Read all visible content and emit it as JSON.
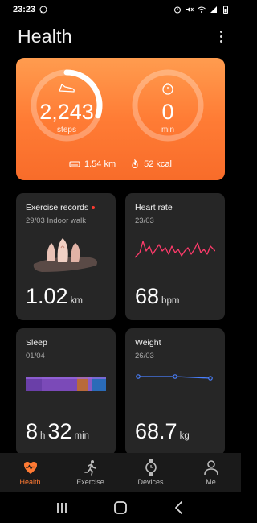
{
  "status": {
    "time": "23:23"
  },
  "header": {
    "title": "Health"
  },
  "activity": {
    "steps": {
      "value": "2,243",
      "unit": "steps",
      "progress": 0.3
    },
    "time": {
      "value": "0",
      "unit": "min",
      "progress": 0
    },
    "distance": "1.54 km",
    "calories": "52 kcal",
    "colors": {
      "gradient_top": "#ff9c4f",
      "gradient_bottom": "#f86c2a"
    }
  },
  "tiles": {
    "exercise": {
      "title": "Exercise records",
      "sub": "29/03 Indoor walk",
      "value": "1.02",
      "unit": "km"
    },
    "heart": {
      "title": "Heart rate",
      "sub": "23/03",
      "value": "68",
      "unit": "bpm",
      "line_color": "#ff3b6b"
    },
    "sleep": {
      "title": "Sleep",
      "sub": "01/04",
      "hours": "8",
      "h_unit": "h",
      "minutes": "32",
      "m_unit": "min"
    },
    "weight": {
      "title": "Weight",
      "sub": "26/03",
      "value": "68.7",
      "unit": "kg",
      "line_color": "#4a80ff"
    }
  },
  "nav": {
    "items": [
      {
        "label": "Health",
        "icon": "heart-pulse-icon",
        "active": true
      },
      {
        "label": "Exercise",
        "icon": "runner-icon",
        "active": false
      },
      {
        "label": "Devices",
        "icon": "watch-icon",
        "active": false
      },
      {
        "label": "Me",
        "icon": "person-icon",
        "active": false
      }
    ],
    "active_color": "#ff7a33"
  },
  "system_nav": {
    "icons": [
      "recents-icon",
      "home-icon",
      "back-icon"
    ]
  }
}
